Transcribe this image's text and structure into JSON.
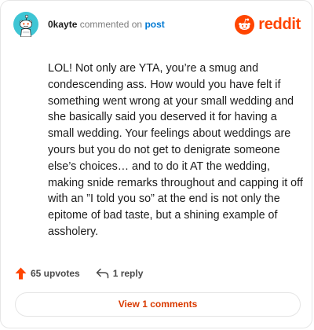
{
  "comment": {
    "username": "0kayte",
    "action_text": "commented on",
    "post_link": "post",
    "body": "LOL! Not only are YTA, you’re a smug and condescending ass. How would you have felt if something went wrong at your small wedding and she basically said you deserved it for having a small wedding. Your feelings about weddings are yours but you do not get to denigrate someone else’s choices… and to do it AT the wedding, making snide remarks throughout and capping it off with an ”I told you so” at the end is not only the epitome of bad taste, but a shining example of assholery."
  },
  "brand": {
    "name": "reddit",
    "color": "#ff4500"
  },
  "actions": {
    "upvotes": "65 upvotes",
    "replies": "1 reply"
  },
  "view_comments_label": "View 1 comments",
  "icons": {
    "avatar": "snoo-avatar-icon",
    "logo": "reddit-logo-icon",
    "upvote": "upvote-arrow-icon",
    "reply": "reply-arrow-icon"
  },
  "colors": {
    "link": "#0079d3",
    "upvote": "#ff4500",
    "view_comments": "#d93a00",
    "avatar_bg": "#3ec5d4"
  }
}
